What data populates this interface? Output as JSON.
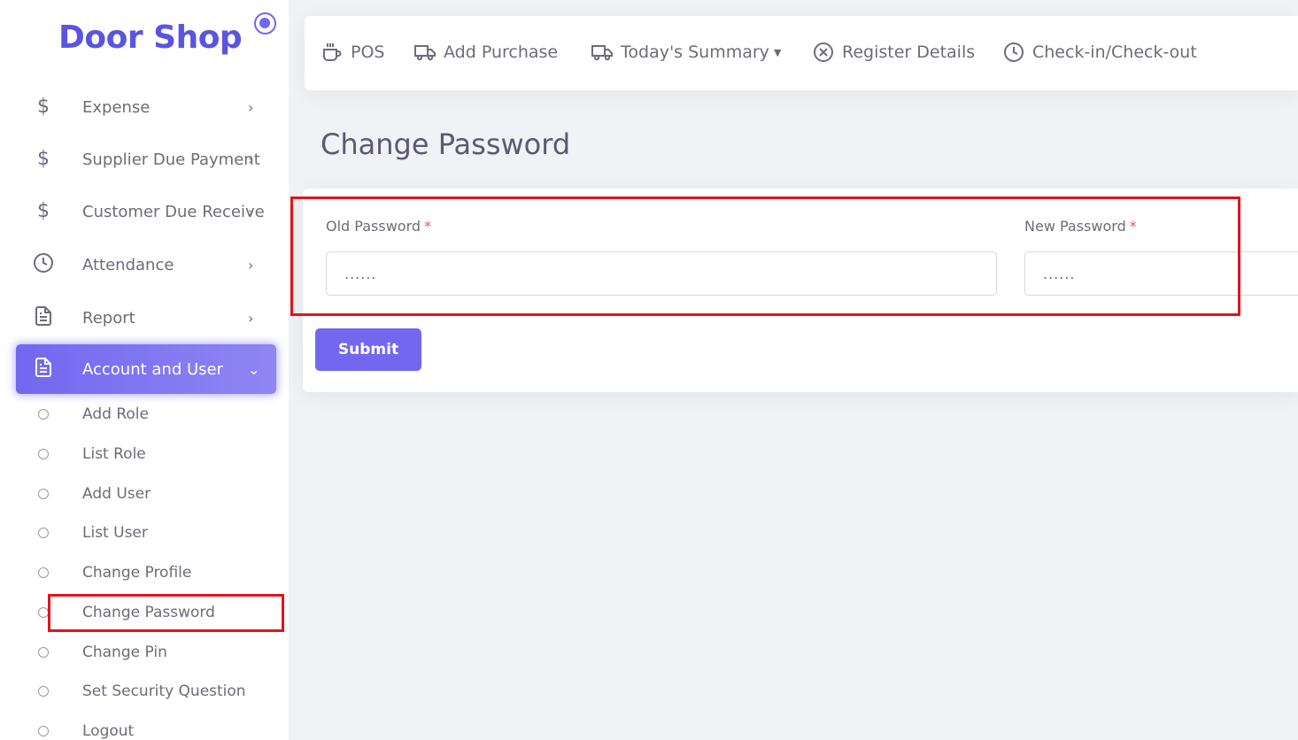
{
  "brand": {
    "name": "Door Shop"
  },
  "sidebar": {
    "items": [
      {
        "label": "Expense",
        "icon": "dollar-icon",
        "has_arrow": true
      },
      {
        "label": "Supplier Due Payment",
        "icon": "dollar-icon",
        "has_arrow": true
      },
      {
        "label": "Customer Due Receive",
        "icon": "dollar-icon",
        "has_arrow": true
      },
      {
        "label": "Attendance",
        "icon": "clock-icon",
        "has_arrow": true
      },
      {
        "label": "Report",
        "icon": "file-icon",
        "has_arrow": true
      },
      {
        "label": "Account and User",
        "icon": "file-icon",
        "has_arrow": true,
        "active": true
      }
    ],
    "sub_items": [
      {
        "label": "Add Role"
      },
      {
        "label": "List Role"
      },
      {
        "label": "Add User"
      },
      {
        "label": "List User"
      },
      {
        "label": "Change Profile"
      },
      {
        "label": "Change Password",
        "highlighted": true
      },
      {
        "label": "Change Pin"
      },
      {
        "label": "Set Security Question"
      },
      {
        "label": "Logout"
      }
    ]
  },
  "navbar": {
    "items": [
      {
        "label": "POS",
        "icon": "cup-icon"
      },
      {
        "label": "Add Purchase",
        "icon": "truck-icon"
      },
      {
        "label": "Today's Summary",
        "icon": "truck-icon",
        "dropdown": true
      },
      {
        "label": "Register Details",
        "icon": "close-circle-icon"
      },
      {
        "label": "Check-in/Check-out",
        "icon": "clock-icon"
      }
    ]
  },
  "page": {
    "title": "Change Password",
    "form": {
      "old_password_label": "Old Password",
      "old_password_value": "......",
      "new_password_label": "New Password",
      "new_password_value": "......",
      "required_mark": "*",
      "submit_label": "Submit"
    }
  },
  "colors": {
    "primary": "#7367f0",
    "brand": "#5a55e0",
    "highlight": "#e0141c",
    "required": "#ea5455",
    "background": "#f0f2f5"
  }
}
